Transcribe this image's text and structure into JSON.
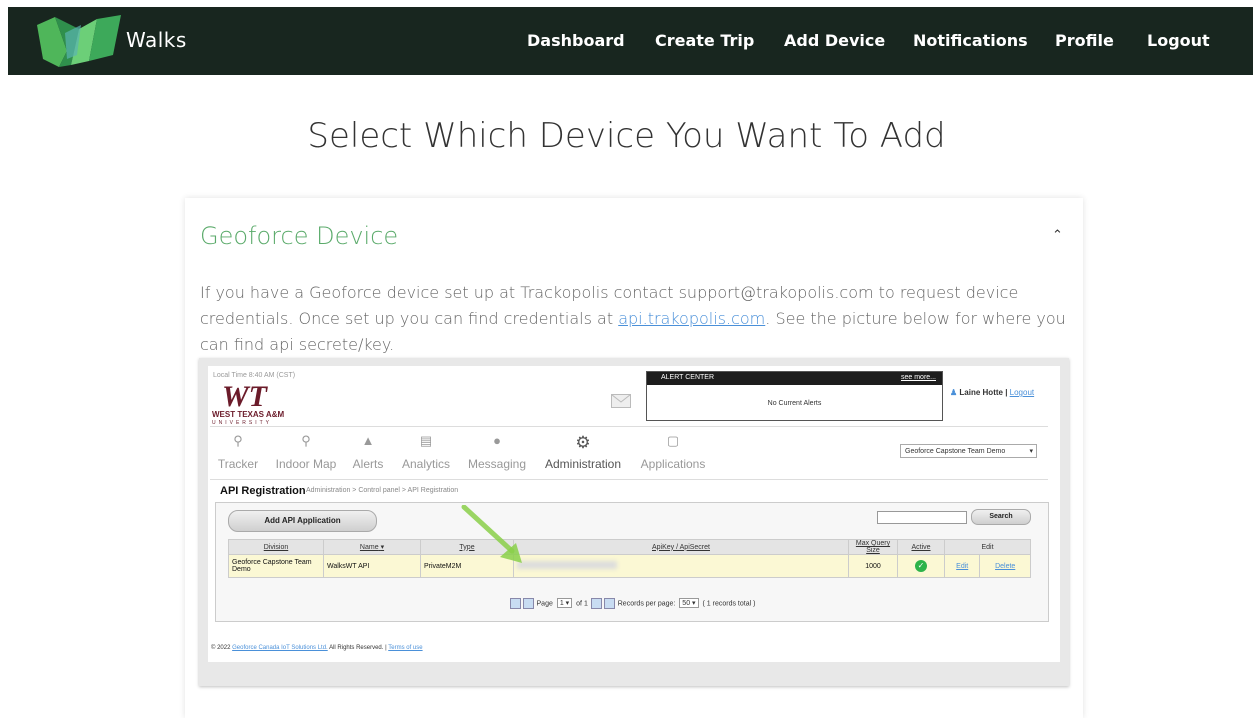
{
  "nav": {
    "brand": "Walks",
    "links": [
      "Dashboard",
      "Create Trip",
      "Add Device",
      "Notifications",
      "Profile",
      "Logout"
    ]
  },
  "page_title": "Select Which Device You Want To Add",
  "card": {
    "title": "Geoforce Device",
    "desc_part1": "If you have a Geoforce device set up at Trackopolis contact support@trakopolis.com to request device credentials. Once set up you can find credentials at ",
    "desc_link": "api.trakopolis.com",
    "desc_part2": ". See the picture below for where you can find api secrete/key."
  },
  "embedded": {
    "local_time": "Local Time 8:40 AM (CST)",
    "logo_mark": "WT",
    "logo_name": "WEST TEXAS A&M",
    "logo_sub": "UNIVERSITY",
    "alert_title": "ALERT CENTER",
    "alert_more": "see more...",
    "alert_body": "No Current Alerts",
    "user_name": "Laine Hotte",
    "user_logout": "Logout",
    "menu": [
      "Tracker",
      "Indoor Map",
      "Alerts",
      "Analytics",
      "Messaging",
      "Administration",
      "Applications"
    ],
    "org_select": "Geoforce Capstone Team Demo",
    "crumb_title": "API Registration",
    "crumb_path": "Administration > Control panel > API Registration",
    "add_button": "Add API Application",
    "search_button": "Search",
    "columns": [
      "Division",
      "Name",
      "Type",
      "ApiKey / ApiSecret",
      "Max Query Size",
      "Active",
      "Edit"
    ],
    "row": {
      "division": "Geoforce Capstone Team Demo",
      "name": "WalksWT API",
      "type": "PrivateM2M",
      "max_query": "1000",
      "edit": "Edit",
      "delete": "Delete"
    },
    "pager": {
      "page_label": "Page",
      "page_value": "1",
      "of_label": "of 1",
      "per_page_label": "Records per page:",
      "per_page_value": "50",
      "total": "( 1 records total )"
    },
    "footer_prefix": "© 2022",
    "footer_company": "Geoforce Canada IoT Solutions Ltd.",
    "footer_rights": "All Rights Reserved.",
    "footer_terms": "Terms of use"
  }
}
